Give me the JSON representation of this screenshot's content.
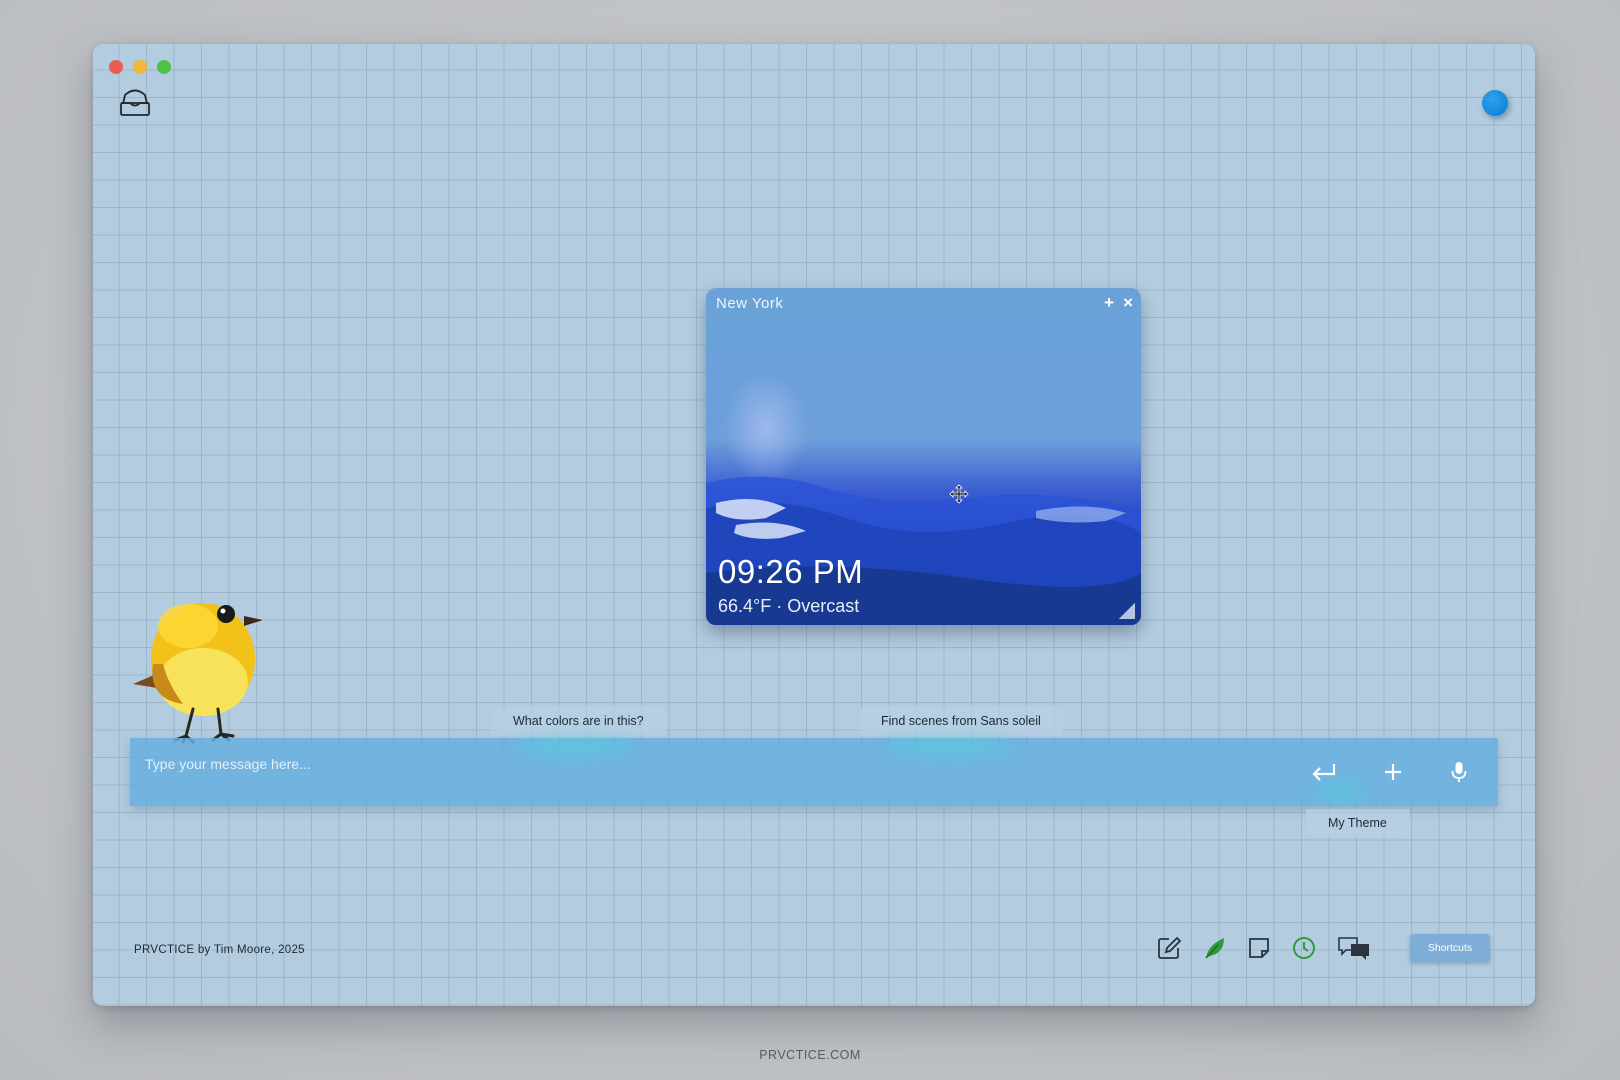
{
  "weather_widget": {
    "city": "New York",
    "time": "09:26 PM",
    "conditions": "66.4°F · Overcast",
    "add_glyph": "+",
    "close_glyph": "×"
  },
  "suggestions": [
    "What colors are in this?",
    "Find scenes from Sans soleil"
  ],
  "message_bar": {
    "placeholder": "Type your message here..."
  },
  "theme_chip": "My Theme",
  "footer": {
    "credit": "PRVCTICE by Tim Moore, 2025",
    "shortcuts_label": "Shortcuts",
    "site": "PRVCTICE.COM"
  },
  "icons": {
    "top_left": "inbox-icon",
    "top_right": "status-dot",
    "toolbar": [
      "edit-icon",
      "leaf-icon",
      "note-icon",
      "clock-icon",
      "chat-icon"
    ],
    "message_bar": [
      "enter-icon",
      "add-icon",
      "microphone-icon"
    ]
  },
  "colors": {
    "canvas": "#b3ccdf",
    "message_bar": "#66aee0",
    "status_dot": "#1b8fe0",
    "leaf_icon": "#2e9a3a",
    "clock_icon": "#2e9a3a"
  }
}
